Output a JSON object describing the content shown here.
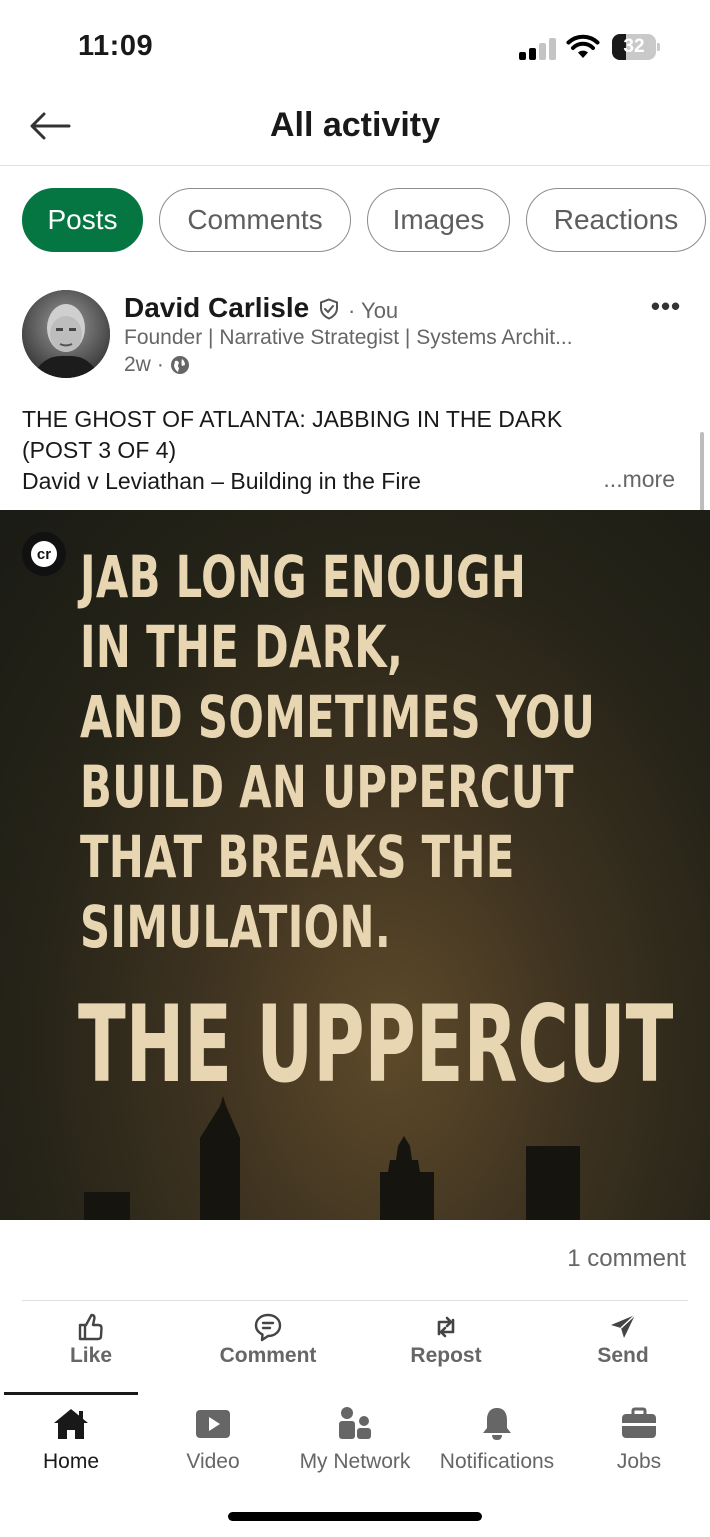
{
  "status_bar": {
    "time": "11:09",
    "battery": "32",
    "battery_level": 0.32,
    "signal_bars": 2
  },
  "header": {
    "back_icon": "arrow-left-icon",
    "title": "All activity"
  },
  "filters": {
    "chips": [
      {
        "label": "Posts",
        "active": true
      },
      {
        "label": "Comments",
        "active": false
      },
      {
        "label": "Images",
        "active": false
      },
      {
        "label": "Reactions",
        "active": false
      }
    ]
  },
  "post": {
    "author": {
      "name": "David Carlisle",
      "relation": "You",
      "headline": "Founder | Narrative Strategist | Systems Archit...",
      "verified_icon": "verified-shield-icon"
    },
    "age": "2w",
    "visibility_icon": "globe-icon",
    "text_line1": "THE GHOST OF ATLANTA: JABBING IN THE DARK",
    "text_line2": "(POST 3 OF 4)",
    "text_line3": "David v Leviathan – Building in the Fire",
    "more_label": "...more",
    "image": {
      "badge": "cr",
      "quote_lines": [
        "JAB LONG ENOUGH",
        "IN THE DARK,",
        "AND SOMETIMES YOU",
        "BUILD AN UPPERCUT",
        "THAT BREAKS THE",
        "SIMULATION."
      ],
      "headline": "THE UPPERCUT"
    },
    "comment_count": "1 comment",
    "actions": [
      {
        "label": "Like",
        "icon": "thumbs-up-icon"
      },
      {
        "label": "Comment",
        "icon": "comment-bubble-icon"
      },
      {
        "label": "Repost",
        "icon": "repost-arrows-icon"
      },
      {
        "label": "Send",
        "icon": "paper-plane-icon"
      }
    ]
  },
  "bottom_nav": [
    {
      "label": "Home",
      "icon": "home-icon",
      "active": true
    },
    {
      "label": "Video",
      "icon": "video-play-icon",
      "active": false
    },
    {
      "label": "My Network",
      "icon": "people-icon",
      "active": false
    },
    {
      "label": "Notifications",
      "icon": "bell-icon",
      "active": false
    },
    {
      "label": "Jobs",
      "icon": "briefcase-icon",
      "active": false
    }
  ],
  "colors": {
    "accent_green": "#057642",
    "text_primary": "#191919",
    "text_secondary": "#666666",
    "image_text": "#e8d6b3"
  }
}
